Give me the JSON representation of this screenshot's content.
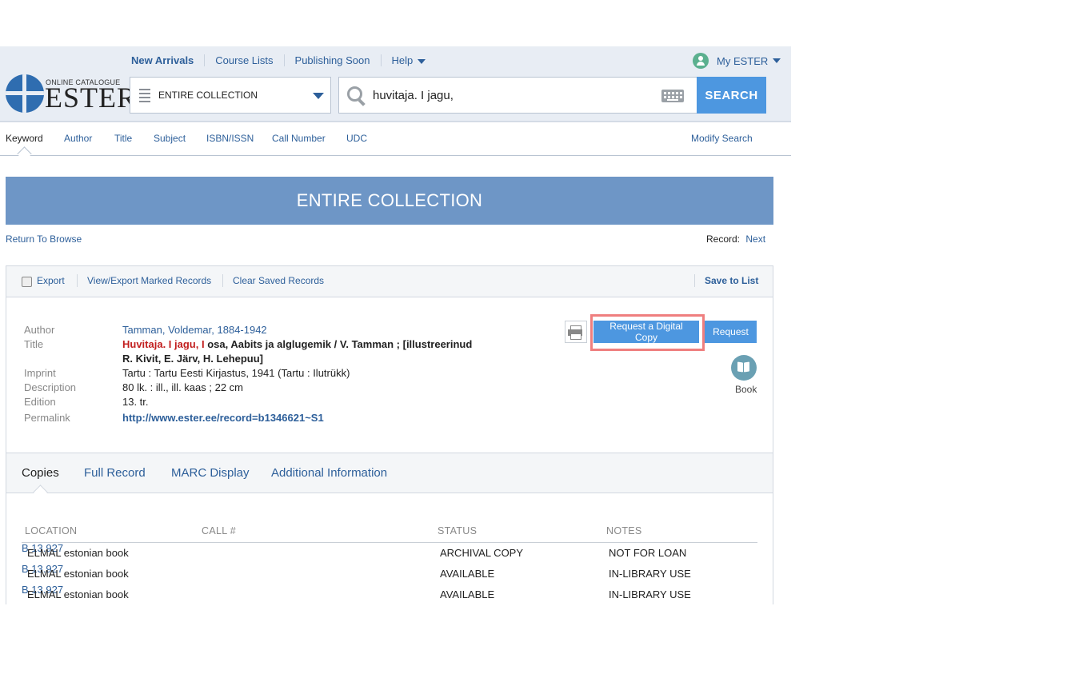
{
  "header": {
    "nav": [
      {
        "label": "New Arrivals"
      },
      {
        "label": "Course Lists"
      },
      {
        "label": "Publishing Soon"
      },
      {
        "label": "Help"
      }
    ],
    "my_ester": "My ESTER",
    "logo": {
      "caption": "ONLINE CATALOGUE",
      "name": "ESTER"
    },
    "scope": "ENTIRE COLLECTION",
    "search_value": "huvitaja. I jagu,",
    "search_button": "SEARCH"
  },
  "index_tabs": [
    "Keyword",
    "Author",
    "Title",
    "Subject",
    "ISBN/ISSN",
    "Call Number",
    "UDC"
  ],
  "modify_search": "Modify Search",
  "banner": "ENTIRE COLLECTION",
  "return_link": "Return To Browse",
  "record_nav": {
    "label": "Record:",
    "next": "Next"
  },
  "toolbar": {
    "export": "Export",
    "view_export": "View/Export Marked Records",
    "clear": "Clear Saved Records",
    "save": "Save to List"
  },
  "record": {
    "labels": {
      "author": "Author",
      "title": "Title",
      "imprint": "Imprint",
      "description": "Description",
      "edition": "Edition",
      "permalink": "Permalink"
    },
    "author": "Tamman, Voldemar, 1884-1942",
    "title_highlight": "Huvitaja. I jagu, I",
    "title_rest": " osa, Aabits ja alglugemik / V. Tamman ; [illustreerinud",
    "title_line2": "R. Kivit, E. Järv, H. Lehepuu]",
    "imprint": "Tartu : Tartu Eesti Kirjastus, 1941 (Tartu : Ilutrükk)",
    "description": "80 lk. : ill., ill. kaas ; 22 cm",
    "edition": "13. tr.",
    "permalink": "http://www.ester.ee/record=b1346621~S1"
  },
  "actions": {
    "digital_copy": "Request a Digital Copy",
    "request": "Request",
    "format": "Book"
  },
  "detail_tabs": [
    "Copies",
    "Full Record",
    "MARC Display",
    "Additional Information"
  ],
  "copies": {
    "headers": [
      "LOCATION",
      "CALL #",
      "STATUS",
      "NOTES"
    ],
    "rows": [
      {
        "location": "ELMAL estonian book",
        "call": "B 13.927",
        "status": "ARCHIVAL COPY",
        "notes": "NOT FOR LOAN"
      },
      {
        "location": "ELMAL estonian book",
        "call": "B 13.927",
        "status": "AVAILABLE",
        "notes": "IN-LIBRARY USE"
      },
      {
        "location": "ELMAL estonian book",
        "call": "B 13.927",
        "status": "AVAILABLE",
        "notes": "IN-LIBRARY USE"
      }
    ]
  },
  "colors": {
    "accent": "#4d97e0",
    "banner": "#6e96c6",
    "highlight": "#c21f1f",
    "link": "#2d5f9a"
  }
}
